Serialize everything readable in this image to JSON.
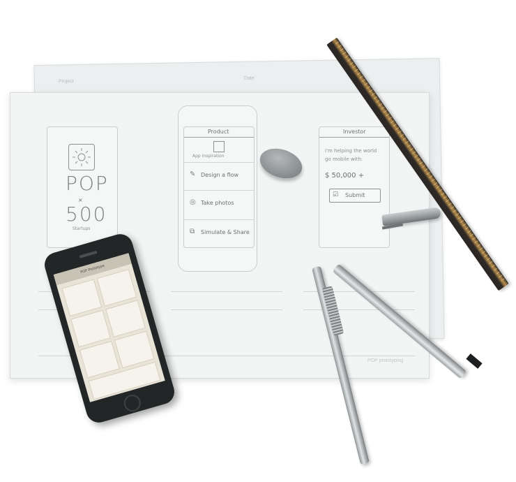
{
  "scene": {
    "back_sheet_labels": [
      "Project",
      "Date"
    ],
    "front_sheet": {
      "screen1": {
        "logo_line1": "POP",
        "logo_line2": "×",
        "logo_line3": "500",
        "logo_line4": "Startups"
      },
      "screen2": {
        "header": "Product",
        "subtitle": "App Inspiration",
        "items": [
          "Design a flow",
          "Take photos",
          "Simulate & Share"
        ]
      },
      "screen3": {
        "header": "Investor",
        "body_line1": "I'm helping the world",
        "body_line2": "go mobile with:",
        "amount": "$ 50,000 +",
        "button": "Submit"
      },
      "footer_brand": "POP prototyping"
    },
    "phone": {
      "app_title": "POP Prototype"
    }
  },
  "colors": {
    "background": "#ffffff",
    "paper": "#f3f5f5",
    "ruler_wood": "#b58b4c",
    "ruler_dark": "#2a2624",
    "phone_body": "#232627"
  },
  "icons": [
    "sun-logo-icon",
    "pencil-icon",
    "camera-icon",
    "share-icon",
    "check-icon"
  ]
}
